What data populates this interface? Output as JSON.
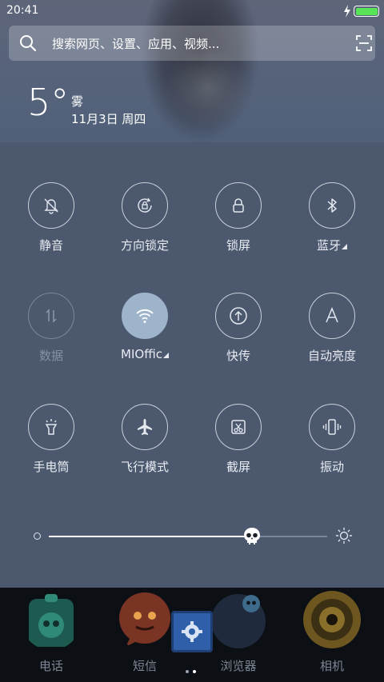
{
  "status_bar": {
    "time": "20:41",
    "battery_level": 1.0
  },
  "search": {
    "placeholder": "搜索网页、设置、应用、视频..."
  },
  "weather": {
    "temperature": "5°",
    "condition": "雾",
    "date": "11月3日 周四"
  },
  "toggles": [
    {
      "label": "静音",
      "icon": "mute-bell-icon",
      "state": "off"
    },
    {
      "label": "方向锁定",
      "icon": "rotation-lock-icon",
      "state": "off"
    },
    {
      "label": "锁屏",
      "icon": "lock-icon",
      "state": "off"
    },
    {
      "label": "蓝牙",
      "icon": "bluetooth-icon",
      "state": "off",
      "has_menu": true
    },
    {
      "label": "数据",
      "icon": "mobile-data-icon",
      "state": "disabled"
    },
    {
      "label": "MIOffic",
      "icon": "wifi-icon",
      "state": "on",
      "has_menu": true
    },
    {
      "label": "快传",
      "icon": "quick-share-icon",
      "state": "off"
    },
    {
      "label": "自动亮度",
      "icon": "auto-brightness-icon",
      "state": "off"
    },
    {
      "label": "手电筒",
      "icon": "flashlight-icon",
      "state": "off"
    },
    {
      "label": "飞行模式",
      "icon": "airplane-icon",
      "state": "off"
    },
    {
      "label": "截屏",
      "icon": "screenshot-icon",
      "state": "off"
    },
    {
      "label": "振动",
      "icon": "vibrate-icon",
      "state": "off"
    }
  ],
  "brightness": {
    "level": 0.73
  },
  "dock": {
    "apps": [
      {
        "label": "电话",
        "icon": "phone-app-icon"
      },
      {
        "label": "短信",
        "icon": "messages-app-icon"
      },
      {
        "label": "浏览器",
        "icon": "browser-app-icon"
      },
      {
        "label": "相机",
        "icon": "camera-app-icon"
      }
    ],
    "page_count": 2,
    "current_page": 2,
    "settings_icon": "settings-app-icon"
  },
  "colors": {
    "panel_bg": "#4b586e",
    "active_toggle": "#9eb4cb",
    "battery_green": "#57e557"
  }
}
